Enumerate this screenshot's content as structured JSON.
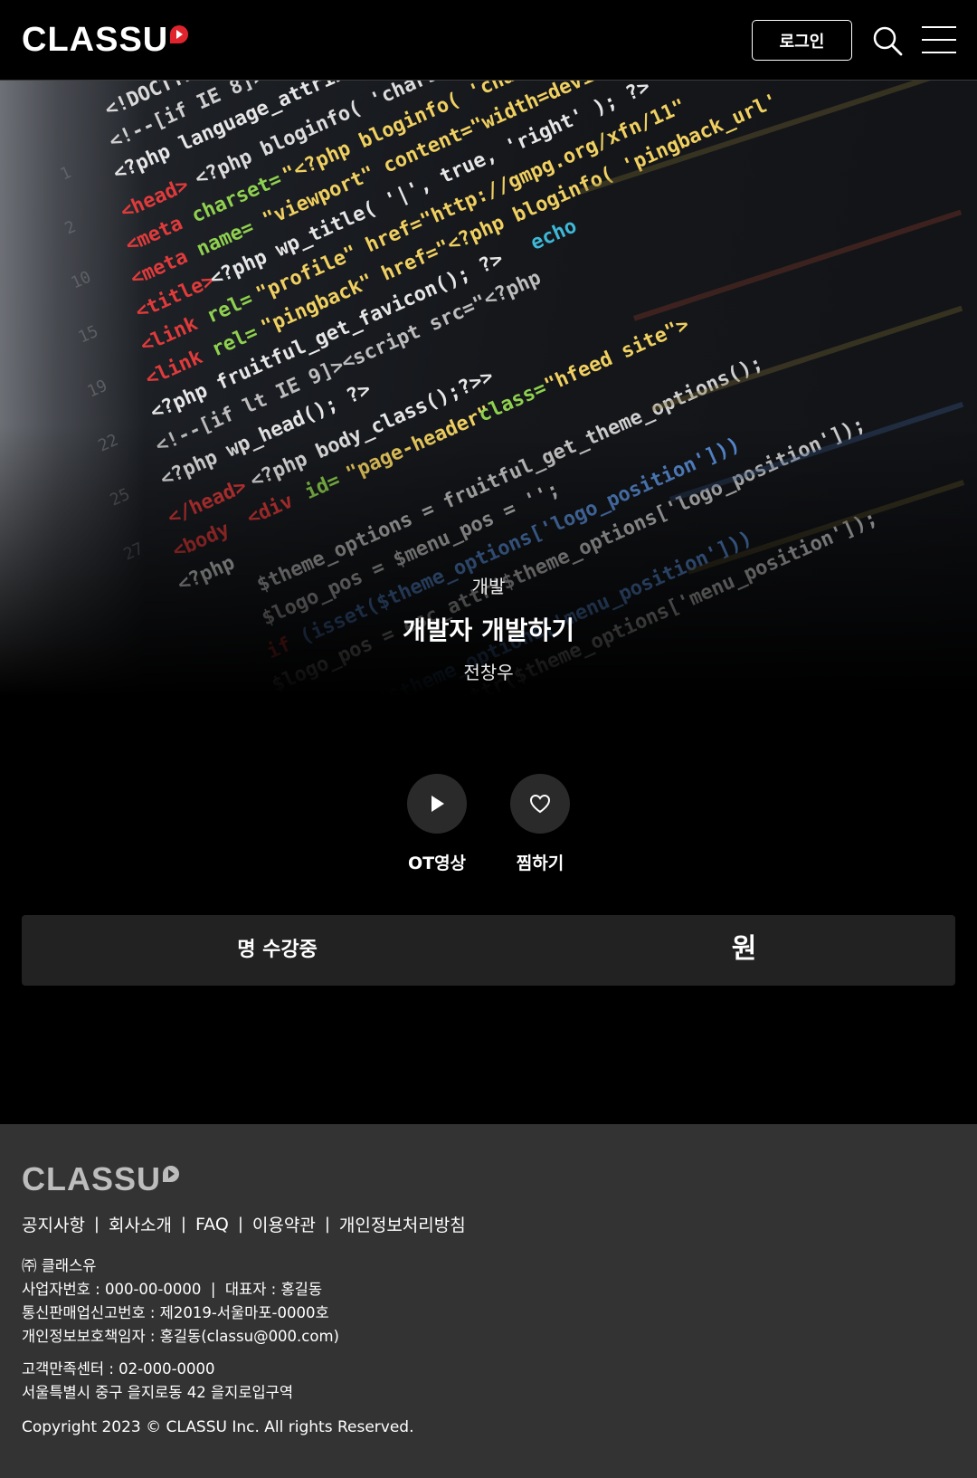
{
  "header": {
    "logo_text": "CLASSU",
    "login_label": "로그인",
    "icons": [
      "search-icon",
      "menu-icon"
    ]
  },
  "hero": {
    "category": "개발",
    "title": "개발자 개발하기",
    "instructor": "전창우"
  },
  "actions": {
    "ot_video_label": "OT영상",
    "wishlist_label": "찜하기"
  },
  "enroll_bar": {
    "students_label": "명 수강중",
    "price_label": "원"
  },
  "footer": {
    "logo_text": "CLASSU",
    "links": [
      "공지사항",
      "회사소개",
      "FAQ",
      "이용약관",
      "개인정보처리방침"
    ],
    "separator": "|",
    "company_name": "㈜ 클래스유",
    "business_line": "사업자번호 : 000-00-0000  |  대표자 : 홍길동",
    "ecommerce_line": "통신판매업신고번호 : 제2019-서울마포-0000호",
    "privacy_officer_line": "개인정보보호책임자 : 홍길동(classu@000.com)",
    "cs_center_line": "고객만족센터 : 02-000-0000",
    "address_line": "서울특별시 중구 을지로동 42 을지로입구역",
    "copyright": "Copyright 2023 © CLASSU Inc. All rights Reserved."
  },
  "colors": {
    "background": "#000000",
    "brand_red": "#e0242d",
    "footer_bg": "#333333",
    "info_bar_bg": "#222222"
  }
}
